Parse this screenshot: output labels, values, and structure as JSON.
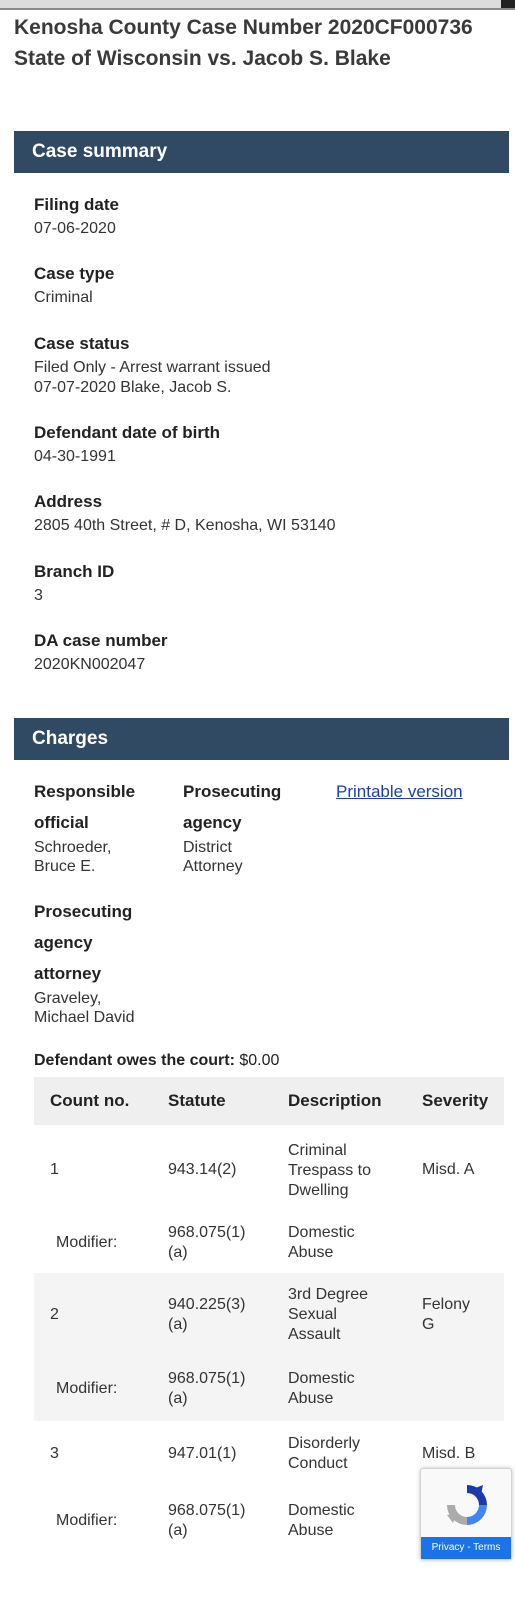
{
  "title": "Kenosha County Case Number 2020CF000736 State of Wisconsin vs. Jacob S. Blake",
  "summary": {
    "header": "Case summary",
    "filing_date": {
      "label": "Filing date",
      "value": "07-06-2020"
    },
    "case_type": {
      "label": "Case type",
      "value": "Criminal"
    },
    "case_status": {
      "label": "Case status",
      "line1": "Filed Only - Arrest warrant issued",
      "line2": "07-07-2020 Blake, Jacob S."
    },
    "dob": {
      "label": "Defendant date of birth",
      "value": "04-30-1991"
    },
    "address": {
      "label": "Address",
      "value": "2805 40th Street, # D, Kenosha, WI 53140"
    },
    "branch": {
      "label": "Branch ID",
      "value": "3"
    },
    "da_case": {
      "label": "DA case number",
      "value": "2020KN002047"
    }
  },
  "charges": {
    "header": "Charges",
    "responsible": {
      "label1": "Responsible",
      "label2": "official",
      "value1": "Schroeder,",
      "value2": "Bruce E."
    },
    "agency": {
      "label1": "Prosecuting",
      "label2": "agency",
      "value1": "District",
      "value2": "Attorney"
    },
    "printable_link": "Printable version",
    "attorney": {
      "label1": "Prosecuting",
      "label2": "agency",
      "label3": "attorney",
      "value1": "Graveley,",
      "value2": "Michael David"
    },
    "owes_label": "Defendant owes the court:",
    "owes_value": "$0.00",
    "table": {
      "headers": [
        "Count no.",
        "Statute",
        "Description",
        "Severity"
      ],
      "rows": [
        {
          "count": "1",
          "statute": [
            "943.14(2)"
          ],
          "description": [
            "Criminal",
            "Trespass to",
            "Dwelling"
          ],
          "severity": [
            "Misd. A"
          ],
          "modifier": {
            "label": "Modifier:",
            "statute": [
              "968.075(1)",
              "(a)"
            ],
            "description": [
              "Domestic",
              "Abuse"
            ]
          }
        },
        {
          "count": "2",
          "statute": [
            "940.225(3)",
            "(a)"
          ],
          "description": [
            "3rd Degree",
            "Sexual",
            "Assault"
          ],
          "severity": [
            "Felony",
            "G"
          ],
          "modifier": {
            "label": "Modifier:",
            "statute": [
              "968.075(1)",
              "(a)"
            ],
            "description": [
              "Domestic",
              "Abuse"
            ]
          }
        },
        {
          "count": "3",
          "statute": [
            "947.01(1)"
          ],
          "description": [
            "Disorderly",
            "Conduct"
          ],
          "severity": [
            "Misd. B"
          ],
          "modifier": {
            "label": "Modifier:",
            "statute": [
              "968.075(1)",
              "(a)"
            ],
            "description": [
              "Domestic",
              "Abuse"
            ]
          }
        }
      ]
    }
  },
  "recaptcha": {
    "footer": "Privacy - Terms",
    "icon": "recaptcha-icon"
  }
}
